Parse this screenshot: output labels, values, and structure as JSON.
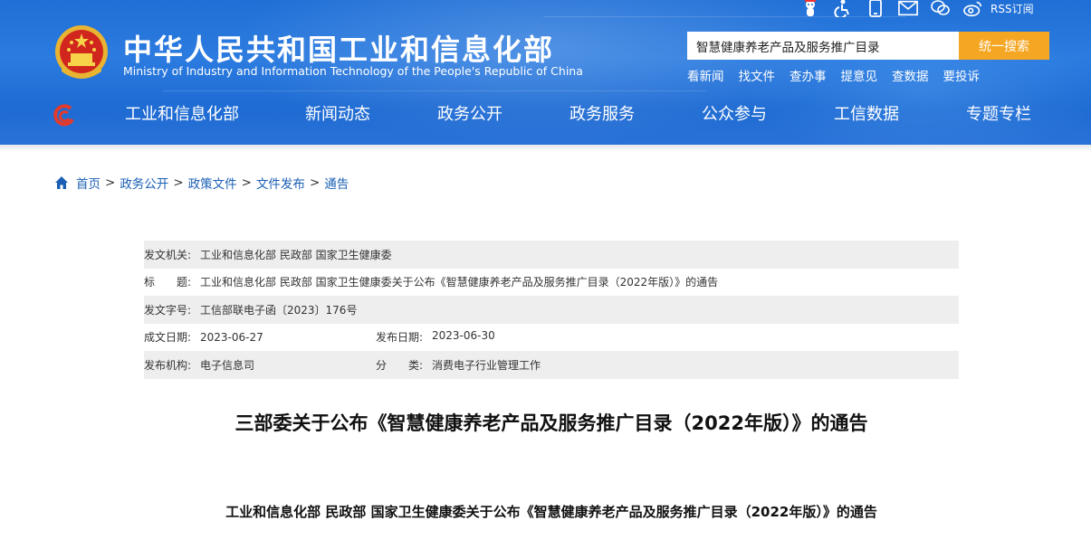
{
  "header": {
    "title": "中华人民共和国工业和信息化部",
    "subtitle": "Ministry of Industry and Information Technology of the People's Republic of China",
    "top_icons": [
      "mascot-icon",
      "accessibility-icon",
      "mobile-icon",
      "mail-icon",
      "wechat-icon",
      "weibo-icon"
    ],
    "rss_label": "RSS订阅",
    "search": {
      "value": "智慧健康养老产品及服务推广目录",
      "button_label": "统一搜索"
    },
    "quick_links": [
      "看新闻",
      "找文件",
      "查办事",
      "提意见",
      "查数据",
      "要投诉"
    ]
  },
  "nav": {
    "items": [
      "工业和信息化部",
      "新闻动态",
      "政务公开",
      "政务服务",
      "公众参与",
      "工信数据",
      "专题专栏"
    ]
  },
  "breadcrumb": {
    "items": [
      "首页",
      "政务公开",
      "政策文件",
      "文件发布",
      "通告"
    ],
    "separator": ">"
  },
  "meta": {
    "issuer_label": "发文机关:",
    "issuer": "工业和信息化部 民政部 国家卫生健康委",
    "title_label": "标　　题:",
    "title": "工业和信息化部 民政部 国家卫生健康委关于公布《智慧健康养老产品及服务推广目录（2022年版）》的通告",
    "doc_number_label": "发文字号:",
    "doc_number": "工信部联电子函〔2023〕176号",
    "created_label": "成文日期:",
    "created": "2023-06-27",
    "published_label": "发布日期:",
    "published": "2023-06-30",
    "agency_label": "发布机构:",
    "agency": "电子信息司",
    "category_label": "分　　类:",
    "category": "消费电子行业管理工作"
  },
  "document": {
    "title": "三部委关于公布《智慧健康养老产品及服务推广目录（2022年版）》的通告",
    "subtitle": "工业和信息化部 民政部 国家卫生健康委关于公布《智慧健康养老产品及服务推广目录（2022年版）》的通告"
  },
  "colors": {
    "header_blue": "#1f6fd6",
    "search_button": "#f5a623",
    "link_blue": "#1a5fb4",
    "meta_shade": "#eeeeee"
  }
}
